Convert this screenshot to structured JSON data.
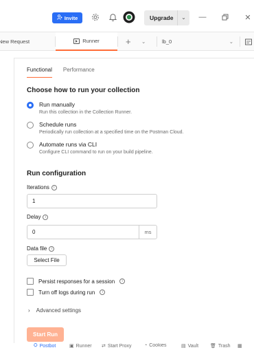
{
  "titlebar": {
    "invite_label": "Invite",
    "upgrade_label": "Upgrade"
  },
  "tabs": {
    "new_request": "New Request",
    "runner": "Runner",
    "environment": "lb_0"
  },
  "runner": {
    "subtabs": [
      "Functional",
      "Performance"
    ],
    "choose_title": "Choose how to run your collection",
    "options": [
      {
        "title": "Run manually",
        "desc": "Run this collection in the Collection Runner.",
        "checked": true
      },
      {
        "title": "Schedule runs",
        "desc": "Periodically run collection at a specified time on the Postman Cloud.",
        "checked": false
      },
      {
        "title": "Automate runs via CLI",
        "desc": "Configure CLI command to run on your build pipeline.",
        "checked": false
      }
    ],
    "config_title": "Run configuration",
    "iterations_label": "Iterations",
    "iterations_value": "1",
    "delay_label": "Delay",
    "delay_value": "0",
    "delay_unit": "ms",
    "data_file_label": "Data file",
    "select_file": "Select File",
    "persist_label": "Persist responses for a session",
    "logs_label": "Turn off logs during run",
    "advanced_label": "Advanced settings",
    "start_label": "Start Run"
  },
  "statusbar": {
    "postbot": "Postbot",
    "runner": "Runner",
    "proxy": "Start Proxy",
    "cookies": "Cookies",
    "vault": "Vault",
    "trash": "Trash"
  },
  "colors": {
    "accent": "#ff6c37",
    "primary_blue": "#2a6ef5",
    "start_button": "#ffb293"
  }
}
